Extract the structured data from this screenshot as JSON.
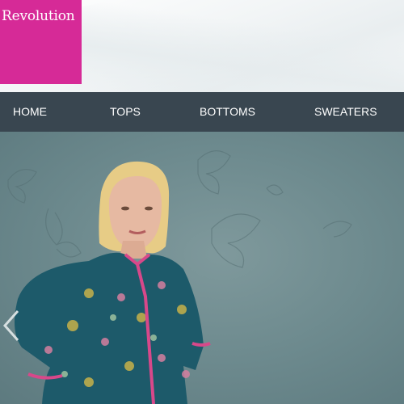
{
  "brand": {
    "logo_text": "Revolution",
    "logo_color": "#d62a97"
  },
  "nav": {
    "background": "#394650",
    "items": [
      {
        "label": "HOME"
      },
      {
        "label": "TOPS"
      },
      {
        "label": "BOTTOMS"
      },
      {
        "label": "SWEATERS"
      }
    ]
  },
  "hero": {
    "slider_prev_icon": "chevron-left-icon",
    "background_color": "#6d8a8e",
    "garment_color": "#1d5a6a",
    "trim_color": "#d8488a"
  }
}
